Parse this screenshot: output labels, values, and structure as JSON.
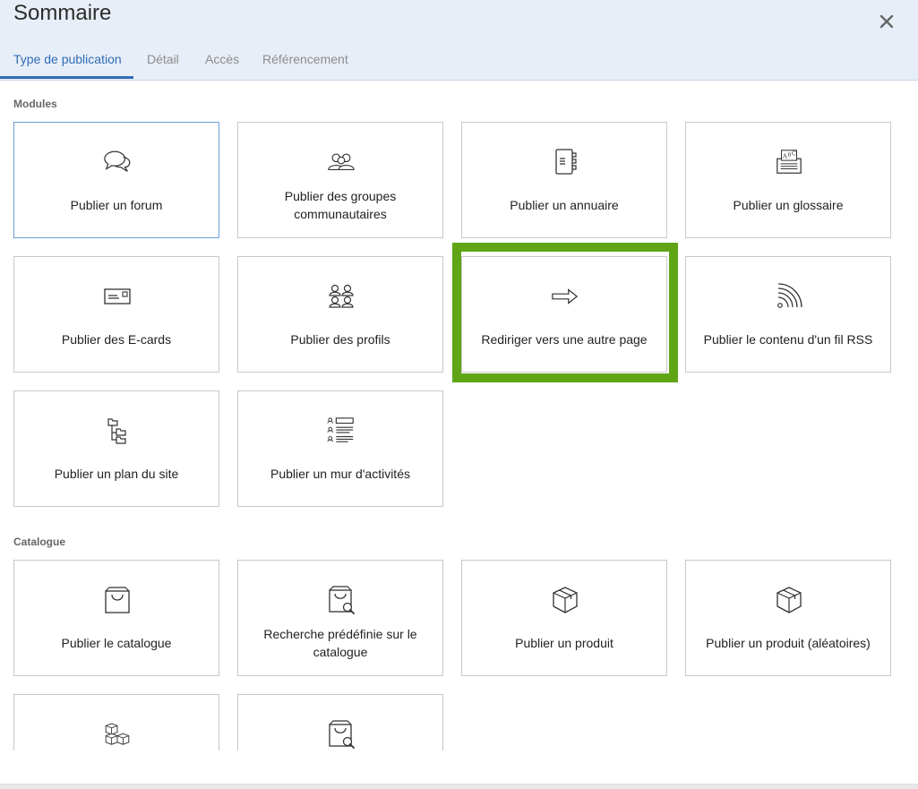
{
  "dialog": {
    "title": "Sommaire"
  },
  "tabs": [
    {
      "label": "Type de publication",
      "active": true
    },
    {
      "label": "Détail",
      "active": false
    },
    {
      "label": "Accès",
      "active": false
    },
    {
      "label": "Référencement",
      "active": false
    }
  ],
  "sections": {
    "modules": {
      "title": "Modules",
      "cards": [
        {
          "label": "Publier un forum",
          "icon": "forum-icon",
          "selected": true
        },
        {
          "label": "Publier des groupes communautaires",
          "icon": "groups-icon"
        },
        {
          "label": "Publier un annuaire",
          "icon": "directory-icon"
        },
        {
          "label": "Publier un glossaire",
          "icon": "glossary-icon"
        },
        {
          "label": "Publier des E-cards",
          "icon": "ecard-icon"
        },
        {
          "label": "Publier des profils",
          "icon": "profiles-icon"
        },
        {
          "label": "Rediriger vers une autre page",
          "icon": "redirect-arrow-icon",
          "highlighted": true
        },
        {
          "label": "Publier le contenu d'un fil RSS",
          "icon": "rss-icon"
        },
        {
          "label": "Publier un plan du site",
          "icon": "sitemap-icon"
        },
        {
          "label": "Publier un mur d'activités",
          "icon": "activity-wall-icon"
        }
      ]
    },
    "catalogue": {
      "title": "Catalogue",
      "cards": [
        {
          "label": "Publier le catalogue",
          "icon": "shopping-bag-icon"
        },
        {
          "label": "Recherche prédéfinie sur le catalogue",
          "icon": "bag-search-icon"
        },
        {
          "label": "Publier un produit",
          "icon": "product-box-icon"
        },
        {
          "label": "Publier un produit (aléatoires)",
          "icon": "product-box-icon"
        },
        {
          "label": "",
          "icon": "boxes-stack-icon"
        },
        {
          "label": "",
          "icon": "bag-search-icon"
        }
      ]
    }
  },
  "colors": {
    "accent": "#2f6db5",
    "highlight": "#5fa516",
    "header_bg": "#e8eef8"
  }
}
